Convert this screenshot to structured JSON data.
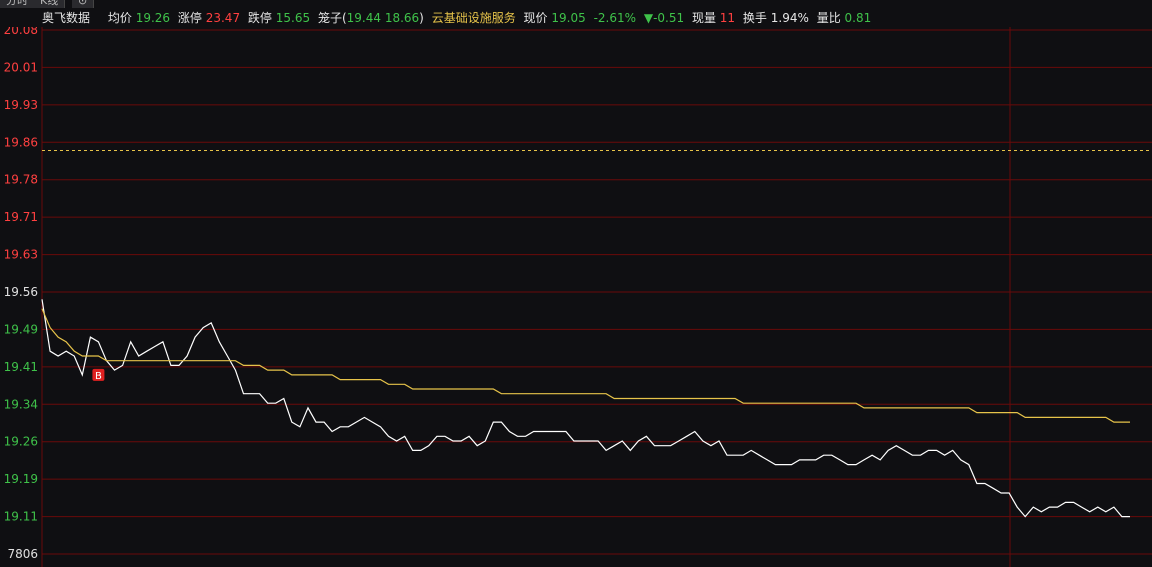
{
  "tabs": [
    "分时",
    "K线",
    "⊙"
  ],
  "header": {
    "stock_name": "奥飞数据",
    "avg_label": "均价",
    "avg_value": "19.26",
    "limit_up_label": "涨停",
    "limit_up_value": "23.47",
    "limit_down_label": "跌停",
    "limit_down_value": "15.65",
    "cage_label": "笼子(",
    "cage_value_1": "19.44",
    "cage_value_2": "18.66",
    "cage_close": ")",
    "sector": "云基础设施服务",
    "price_label": "现价",
    "price_value": "19.05",
    "pct_change": "-2.61%",
    "change": "▼-0.51",
    "volume_label": "现量",
    "volume_value": "11",
    "turnover_label": "换手",
    "turnover_value": "1.94%",
    "vol_ratio_label": "量比",
    "vol_ratio_value": "0.81"
  },
  "colors": {
    "up": "#ff4040",
    "down": "#3fc24a",
    "grid": "#6a0a0a",
    "price": "#ffffff",
    "avg": "#e6c34a",
    "background": "#0f0f12"
  },
  "chart_data": {
    "type": "line",
    "title": "",
    "xlabel": "",
    "ylabel": "",
    "ylim": [
      19.05,
      20.08
    ],
    "prev_close": 19.825,
    "y_tick_labels": [
      "20.08",
      "20.01",
      "19.93",
      "19.86",
      "19.78",
      "19.71",
      "19.63",
      "19.56",
      "19.49",
      "19.41",
      "19.34",
      "19.26",
      "19.19",
      "19.11",
      "7806"
    ],
    "y_tick_colors": [
      "red",
      "red",
      "red",
      "red",
      "red",
      "red",
      "red",
      "white",
      "green",
      "green",
      "green",
      "green",
      "green",
      "green",
      "white"
    ],
    "buy_marker": {
      "label": "B",
      "index": 2,
      "price": 19.35
    },
    "series": [
      {
        "key": "price",
        "color": "#ffffff",
        "values": [
          19.51,
          19.4,
          19.39,
          19.4,
          19.39,
          19.35,
          19.43,
          19.42,
          19.38,
          19.36,
          19.37,
          19.42,
          19.39,
          19.4,
          19.41,
          19.42,
          19.37,
          19.37,
          19.39,
          19.43,
          19.45,
          19.46,
          19.42,
          19.39,
          19.36,
          19.31,
          19.31,
          19.31,
          19.29,
          19.29,
          19.3,
          19.25,
          19.24,
          19.28,
          19.25,
          19.25,
          19.23,
          19.24,
          19.24,
          19.25,
          19.26,
          19.25,
          19.24,
          19.22,
          19.21,
          19.22,
          19.19,
          19.19,
          19.2,
          19.22,
          19.22,
          19.21,
          19.21,
          19.22,
          19.2,
          19.21,
          19.25,
          19.25,
          19.23,
          19.22,
          19.22,
          19.23,
          19.23,
          19.23,
          19.23,
          19.23,
          19.21,
          19.21,
          19.21,
          19.21,
          19.19,
          19.2,
          19.21,
          19.19,
          19.21,
          19.22,
          19.2,
          19.2,
          19.2,
          19.21,
          19.22,
          19.23,
          19.21,
          19.2,
          19.21,
          19.18,
          19.18,
          19.18,
          19.19,
          19.18,
          19.17,
          19.16,
          19.16,
          19.16,
          19.17,
          19.17,
          19.17,
          19.18,
          19.18,
          19.17,
          19.16,
          19.16,
          19.17,
          19.18,
          19.17,
          19.19,
          19.2,
          19.19,
          19.18,
          19.18,
          19.19,
          19.19,
          19.18,
          19.19,
          19.17,
          19.16,
          19.12,
          19.12,
          19.11,
          19.1,
          19.1,
          19.07,
          19.05,
          19.07,
          19.06,
          19.07,
          19.07,
          19.08,
          19.08,
          19.07,
          19.06,
          19.07,
          19.06,
          19.07,
          19.05,
          19.05
        ]
      },
      {
        "key": "avg",
        "color": "#e6c34a",
        "values": [
          19.49,
          19.45,
          19.43,
          19.42,
          19.4,
          19.39,
          19.39,
          19.39,
          19.38,
          19.38,
          19.38,
          19.38,
          19.38,
          19.38,
          19.38,
          19.38,
          19.38,
          19.38,
          19.38,
          19.38,
          19.38,
          19.38,
          19.38,
          19.38,
          19.38,
          19.37,
          19.37,
          19.37,
          19.36,
          19.36,
          19.36,
          19.35,
          19.35,
          19.35,
          19.35,
          19.35,
          19.35,
          19.34,
          19.34,
          19.34,
          19.34,
          19.34,
          19.34,
          19.33,
          19.33,
          19.33,
          19.32,
          19.32,
          19.32,
          19.32,
          19.32,
          19.32,
          19.32,
          19.32,
          19.32,
          19.32,
          19.32,
          19.31,
          19.31,
          19.31,
          19.31,
          19.31,
          19.31,
          19.31,
          19.31,
          19.31,
          19.31,
          19.31,
          19.31,
          19.31,
          19.31,
          19.3,
          19.3,
          19.3,
          19.3,
          19.3,
          19.3,
          19.3,
          19.3,
          19.3,
          19.3,
          19.3,
          19.3,
          19.3,
          19.3,
          19.3,
          19.3,
          19.29,
          19.29,
          19.29,
          19.29,
          19.29,
          19.29,
          19.29,
          19.29,
          19.29,
          19.29,
          19.29,
          19.29,
          19.29,
          19.29,
          19.29,
          19.28,
          19.28,
          19.28,
          19.28,
          19.28,
          19.28,
          19.28,
          19.28,
          19.28,
          19.28,
          19.28,
          19.28,
          19.28,
          19.28,
          19.27,
          19.27,
          19.27,
          19.27,
          19.27,
          19.27,
          19.26,
          19.26,
          19.26,
          19.26,
          19.26,
          19.26,
          19.26,
          19.26,
          19.26,
          19.26,
          19.26,
          19.25,
          19.25,
          19.25
        ]
      }
    ]
  }
}
